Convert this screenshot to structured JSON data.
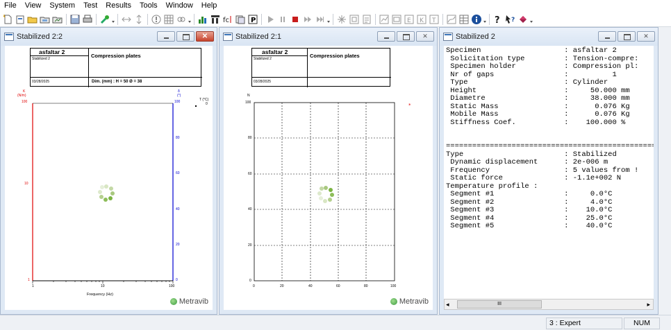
{
  "menu": [
    "File",
    "View",
    "System",
    "Test",
    "Results",
    "Tools",
    "Window",
    "Help"
  ],
  "win1": {
    "title": "Stabilized 2:2",
    "specimen_name": "asfaltar 2",
    "specimen_sub": "Stabilized 2",
    "holder": "Compression plates",
    "date": "03/28/2025",
    "dims": "Dim. (mm)  : H = 50  Ø = 38",
    "k_label": "K",
    "k_unit": "(N/m)",
    "k_top": "100",
    "k_mid": "10",
    "k_bot": "1",
    "delta_label": "δ",
    "delta_unit": "(°)",
    "delta_top": "100",
    "t_label": "T (°C)",
    "t_zero": "0",
    "right_ticks": [
      "100",
      "80",
      "60",
      "40",
      "20",
      "0"
    ],
    "x_ticks": [
      "1",
      "10",
      "100"
    ],
    "xlabel": "Frequency (Hz)",
    "watermark": "Metravib"
  },
  "win2": {
    "title": "Stabilized 2:1",
    "specimen_name": "asfaltar 2",
    "specimen_sub": "Stabilized 2",
    "holder": "Compression plates",
    "date": "03/28/2025",
    "n_label": "N",
    "y_ticks": [
      "100",
      "80",
      "60",
      "40",
      "20",
      "0"
    ],
    "x_ticks": [
      "0",
      "20",
      "40",
      "60",
      "80",
      "100"
    ],
    "watermark": "Metravib"
  },
  "win3": {
    "title": "Stabilized 2",
    "lines": [
      "Specimen                   : asfaltar 2",
      " Solicitation type         : Tension-compre:",
      " Specimen holder           : Compression pl:",
      " Nr of gaps                :          1",
      " Type                      : Cylinder",
      " Height                    :     50.000 mm",
      " Diametre                  :     38.000 mm",
      " Static Mass               :      0.076 Kg",
      " Mobile Mass               :      0.076 Kg",
      " Stiffness Coef.           :    100.000 %",
      "",
      "",
      "================================================",
      "Type                       : Stabilized",
      " Dynamic displacement      : 2e-006 m",
      " Frequency                 : 5 values from !",
      " Static force              : -1.1e+002 N",
      "Temperature profile :",
      " Segment #1                :     0.0°C",
      " Segment #2                :     4.0°C",
      " Segment #3                :    10.0°C",
      " Segment #4                :    25.0°C",
      " Segment #5                :    40.0°C"
    ],
    "hscroll_grip": "III"
  },
  "status": {
    "mode": "3 : Expert",
    "num": "NUM"
  },
  "colors": {
    "k_axis": "#e00000",
    "right_axis": "#0000d0",
    "spinner_green": "#7bb342"
  }
}
